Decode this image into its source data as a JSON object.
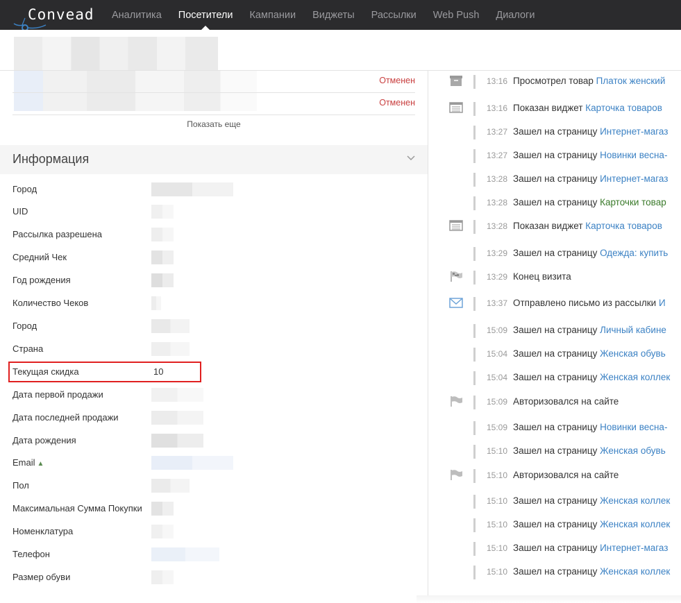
{
  "nav": {
    "logo": "Convead",
    "items": [
      {
        "label": "Аналитика",
        "active": false
      },
      {
        "label": "Посетители",
        "active": true
      },
      {
        "label": "Кампании",
        "active": false
      },
      {
        "label": "Виджеты",
        "active": false
      },
      {
        "label": "Рассылки",
        "active": false
      },
      {
        "label": "Web Push",
        "active": false
      },
      {
        "label": "Диалоги",
        "active": false
      }
    ]
  },
  "orders": {
    "rows": [
      {
        "status": "Отменен"
      },
      {
        "status": "Отменен"
      }
    ],
    "show_more": "Показать еще"
  },
  "info": {
    "title": "Информация",
    "rows": [
      {
        "label": "Город",
        "value": ""
      },
      {
        "label": "UID",
        "value": ""
      },
      {
        "label": "Рассылка разрешена",
        "value": ""
      },
      {
        "label": "Средний Чек",
        "value": ""
      },
      {
        "label": "Год рождения",
        "value": ""
      },
      {
        "label": "Количество Чеков",
        "value": ""
      },
      {
        "label": "Город",
        "value": ""
      },
      {
        "label": "Страна",
        "value": ""
      },
      {
        "label": "Текущая скидка",
        "value": "10"
      },
      {
        "label": "Дата первой продажи",
        "value": ""
      },
      {
        "label": "Дата последней продажи",
        "value": ""
      },
      {
        "label": "Дата рождения",
        "value": ""
      },
      {
        "label": "Email",
        "value": ""
      },
      {
        "label": "Пол",
        "value": ""
      },
      {
        "label": "Максимальная Сумма Покупки",
        "value": ""
      },
      {
        "label": "Номенклатура",
        "value": ""
      },
      {
        "label": "Телефон",
        "value": ""
      },
      {
        "label": "Размер обуви",
        "value": ""
      }
    ]
  },
  "timeline": [
    {
      "icon": "box-icon",
      "time": "13:16",
      "text": "Просмотрел товар ",
      "link": "Платок женский"
    },
    {
      "icon": "widget-icon",
      "time": "13:16",
      "text": "Показан виджет ",
      "link": "Карточка товаров"
    },
    {
      "icon": "",
      "time": "13:27",
      "text": "Зашел на страницу ",
      "link": "Интернет-магаз"
    },
    {
      "icon": "",
      "time": "13:27",
      "text": "Зашел на страницу ",
      "link": "Новинки весна-"
    },
    {
      "icon": "",
      "time": "13:28",
      "text": "Зашел на страницу ",
      "link": "Интернет-магаз"
    },
    {
      "icon": "",
      "time": "13:28",
      "text": "Зашел на страницу ",
      "link": "Карточки товар",
      "green": true
    },
    {
      "icon": "widget-icon",
      "time": "13:28",
      "text": "Показан виджет ",
      "link": "Карточка товаров"
    },
    {
      "icon": "",
      "time": "13:29",
      "text": "Зашел на страницу ",
      "link": "Одежда: купить"
    },
    {
      "icon": "checkered-flag-icon",
      "time": "13:29",
      "text": "Конец визита",
      "link": ""
    },
    {
      "icon": "envelope-icon",
      "time": "13:37",
      "text": "Отправлено письмо из рассылки ",
      "link": "И"
    },
    {
      "icon": "",
      "time": "15:09",
      "text": "Зашел на страницу ",
      "link": "Личный кабине"
    },
    {
      "icon": "",
      "time": "15:04",
      "text": "Зашел на страницу ",
      "link": "Женская обувь"
    },
    {
      "icon": "",
      "time": "15:04",
      "text": "Зашел на страницу ",
      "link": "Женская коллек"
    },
    {
      "icon": "flag-icon",
      "time": "15:09",
      "text": "Авторизовался на сайте",
      "link": ""
    },
    {
      "icon": "",
      "time": "15:09",
      "text": "Зашел на страницу ",
      "link": "Новинки весна-"
    },
    {
      "icon": "",
      "time": "15:10",
      "text": "Зашел на страницу ",
      "link": "Женская обувь"
    },
    {
      "icon": "flag-icon",
      "time": "15:10",
      "text": "Авторизовался на сайте",
      "link": ""
    },
    {
      "icon": "",
      "time": "15:10",
      "text": "Зашел на страницу ",
      "link": "Женская коллек"
    },
    {
      "icon": "",
      "time": "15:10",
      "text": "Зашел на страницу ",
      "link": "Женская коллек"
    },
    {
      "icon": "",
      "time": "15:10",
      "text": "Зашел на страницу ",
      "link": "Интернет-магаз"
    },
    {
      "icon": "",
      "time": "15:10",
      "text": "Зашел на страницу ",
      "link": "Женская коллек"
    }
  ],
  "colors": {
    "nav_bg": "#2b2b2d",
    "link": "#3c82c4",
    "status_cancelled": "#c94040",
    "highlight": "#e02020"
  }
}
